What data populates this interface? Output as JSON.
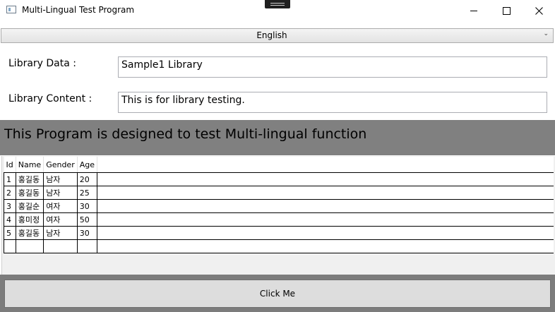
{
  "window": {
    "title": "Multi-Lingual Test Program"
  },
  "language_select": {
    "selected": "English",
    "arrow": "⌄"
  },
  "form": {
    "library_data_label": "Library Data :",
    "library_data_value": "Sample1 Library",
    "library_content_label": "Library Content :",
    "library_content_value": "This is for library testing."
  },
  "banner": {
    "text": "This Program is designed to test Multi-lingual function",
    "background": "#808080"
  },
  "grid": {
    "columns": [
      "Id",
      "Name",
      "Gender",
      "Age"
    ],
    "rows": [
      [
        "1",
        "홍길동",
        "남자",
        "20"
      ],
      [
        "2",
        "홍길동",
        "남자",
        "25"
      ],
      [
        "3",
        "홍길순",
        "여자",
        "30"
      ],
      [
        "4",
        "홍미정",
        "여자",
        "50"
      ],
      [
        "5",
        "홍길동",
        "남자",
        "30"
      ]
    ]
  },
  "action": {
    "button_label": "Click Me"
  }
}
